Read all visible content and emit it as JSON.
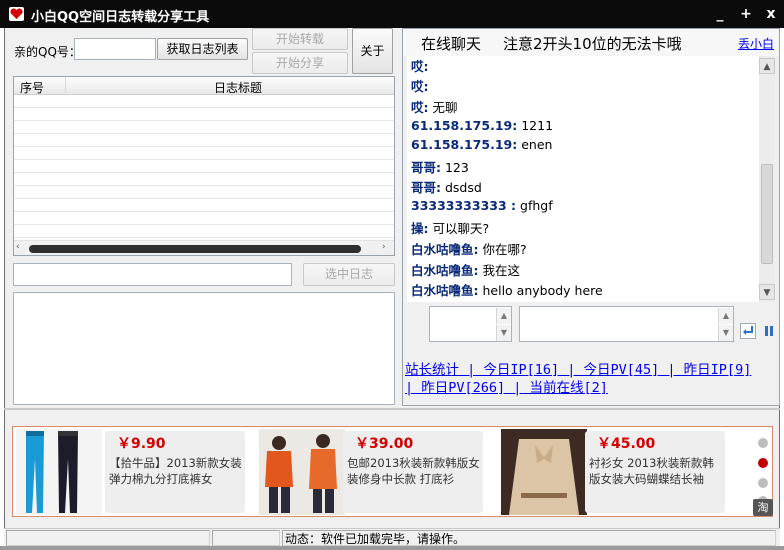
{
  "window": {
    "title": "小白QQ空间日志转载分享工具",
    "controls": [
      "_",
      "+",
      "x"
    ]
  },
  "left": {
    "qq_label": "亲的QQ号：",
    "qq_value": "",
    "fetch_button": "获取日志列表",
    "start_repost_button": "开始转载",
    "start_share_button": "开始分享",
    "about_button": "关于",
    "columns": [
      "序号",
      "日志标题"
    ],
    "selected_value": "",
    "select_log_button": "选中日志"
  },
  "chat": {
    "title": "在线聊天",
    "notice": "注意2开头10位的无法卡哦",
    "hide_link": "丢小白",
    "messages": [
      {
        "nick": "哎:",
        "text": ""
      },
      {
        "nick": "哎:",
        "text": ""
      },
      {
        "nick": "哎:",
        "text": "无聊"
      },
      {
        "nick": "61.158.175.19:",
        "text": "1211"
      },
      {
        "nick": "61.158.175.19:",
        "text": "enen"
      },
      {
        "nick": "哥哥:",
        "text": "123"
      },
      {
        "nick": "哥哥:",
        "text": "dsdsd"
      },
      {
        "nick": "33333333333 :",
        "text": "gfhgf"
      },
      {
        "nick": "操:",
        "text": "可以聊天?"
      },
      {
        "nick": "白水咕噜鱼:",
        "text": "你在哪?"
      },
      {
        "nick": "白水咕噜鱼:",
        "text": "我在这"
      },
      {
        "nick": "白水咕噜鱼:",
        "text": "hello anybody here"
      }
    ],
    "stats_line1": "站长统计 | 今日IP[16] | 今日PV[45] | 昨日IP[9]",
    "stats_line2": "| 昨日PV[266] | 当前在线[2]"
  },
  "ads": [
    {
      "price": "￥9.90",
      "desc": "【拾牛品】2013新款女装 弹力棉九分打底裤女"
    },
    {
      "price": "￥39.00",
      "desc": "包邮2013秋装新款韩版女装修身中长款 打底衫"
    },
    {
      "price": "￥45.00",
      "desc": "衬衫女 2013秋装新款韩版女装大码蝴蝶结长袖"
    }
  ],
  "ad_badge": "淘",
  "status": {
    "text": "动态：软件已加载完毕，请操作。"
  }
}
